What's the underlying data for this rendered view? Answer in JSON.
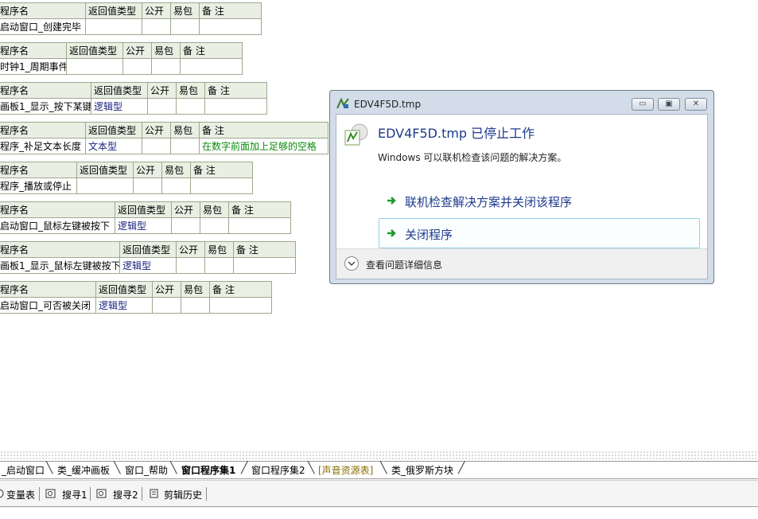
{
  "tables": [
    {
      "header": [
        "程序名",
        "返回值类型",
        "公开",
        "易包",
        "备 注"
      ],
      "row": [
        "启动窗口_创建完毕",
        "",
        "",
        "",
        ""
      ]
    },
    {
      "header": [
        "程序名",
        "返回值类型",
        "公开",
        "易包",
        "备 注"
      ],
      "row": [
        "时钟1_周期事件",
        "",
        "",
        "",
        ""
      ]
    },
    {
      "header": [
        "程序名",
        "返回值类型",
        "公开",
        "易包",
        "备 注"
      ],
      "row": [
        "画板1_显示_按下某键",
        "逻辑型",
        "",
        "",
        ""
      ]
    },
    {
      "header": [
        "程序名",
        "返回值类型",
        "公开",
        "易包",
        "备 注"
      ],
      "row": [
        "程序_补足文本长度",
        "文本型",
        "",
        "",
        "在数字前面加上足够的空格"
      ]
    },
    {
      "header": [
        "程序名",
        "返回值类型",
        "公开",
        "易包",
        "备 注"
      ],
      "row": [
        "程序_播放或停止",
        "",
        "",
        "",
        ""
      ]
    },
    {
      "header": [
        "程序名",
        "返回值类型",
        "公开",
        "易包",
        "备 注"
      ],
      "row": [
        "启动窗口_鼠标左键被按下",
        "逻辑型",
        "",
        "",
        ""
      ]
    },
    {
      "header": [
        "程序名",
        "返回值类型",
        "公开",
        "易包",
        "备 注"
      ],
      "row": [
        "画板1_显示_鼠标左键被按下",
        "逻辑型",
        "",
        "",
        ""
      ]
    },
    {
      "header": [
        "程序名",
        "返回值类型",
        "公开",
        "易包",
        "备 注"
      ],
      "row": [
        "启动窗口_可否被关闭",
        "逻辑型",
        "",
        "",
        ""
      ]
    }
  ],
  "dialog": {
    "title": "EDV4F5D.tmp",
    "main_message": "EDV4F5D.tmp 已停止工作",
    "sub_message": "Windows 可以联机检查该问题的解决方案。",
    "option_check_online": "联机检查解决方案并关闭该程序",
    "option_close": "关闭程序",
    "details_label": "查看问题详细信息",
    "minimize_glyph": "▭",
    "restore_glyph": "▣",
    "close_glyph": "✕"
  },
  "tabs": [
    "_启动窗口",
    "类_缓冲画板",
    "窗口_帮助",
    "窗口程序集1",
    "窗口程序集2",
    "[声音资源表]",
    "类_俄罗斯方块"
  ],
  "toolbar": {
    "vars": "变量表",
    "search1": "搜寻1",
    "search2": "搜寻2",
    "clip_history": "剪辑历史"
  },
  "colors": {
    "table_header_bg": "#e9efe2",
    "table_border": "#9fa78f",
    "type_text": "#1a237e",
    "remark_text": "#0c8a0c",
    "dialog_link": "#1e3a8c",
    "resource_tab": "#8a6d00"
  }
}
